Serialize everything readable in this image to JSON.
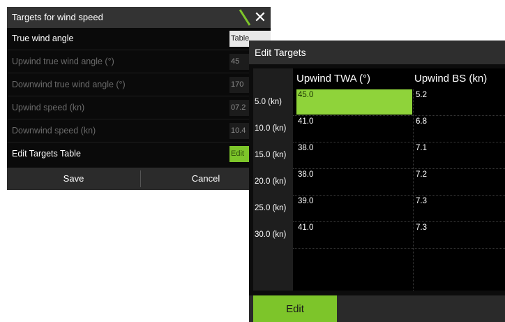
{
  "dialog1": {
    "title": "Targets for wind speed",
    "rows": [
      {
        "label": "True wind angle",
        "value": "Table"
      },
      {
        "label": "Upwind true wind angle (°)",
        "value": "45"
      },
      {
        "label": "Downwind true wind angle (°)",
        "value": "170"
      },
      {
        "label": "Upwind speed (kn)",
        "value": "07.2"
      },
      {
        "label": "Downwind speed (kn)",
        "value": "10.4"
      },
      {
        "label": "Edit Targets Table",
        "value": "Edit"
      }
    ],
    "footer": {
      "save_label": "Save",
      "cancel_label": "Cancel"
    },
    "colors": {
      "accent": "#7dc52a",
      "header_bg": "#333333",
      "body_bg": "#0a0a0a"
    }
  },
  "dialog2": {
    "title": "Edit Targets",
    "columns": [
      "Upwind TWA (°)",
      "Upwind BS (kn)"
    ],
    "rows": [
      {
        "label": "5.0 (kn)",
        "twa": "45.0",
        "bs": "5.2"
      },
      {
        "label": "10.0 (kn)",
        "twa": "41.0",
        "bs": "6.8"
      },
      {
        "label": "15.0 (kn)",
        "twa": "38.0",
        "bs": "7.1"
      },
      {
        "label": "20.0 (kn)",
        "twa": "38.0",
        "bs": "7.2"
      },
      {
        "label": "25.0 (kn)",
        "twa": "39.0",
        "bs": "7.3"
      },
      {
        "label": "30.0 (kn)",
        "twa": "41.0",
        "bs": "7.3"
      }
    ],
    "edit_label": "Edit",
    "selected_cell": {
      "row": 0,
      "column": 0
    },
    "colors": {
      "selected": "#8fd33a",
      "accent": "#7dc52a"
    }
  },
  "icons": {
    "close": "close-icon",
    "slash": "slash-mark-icon"
  }
}
